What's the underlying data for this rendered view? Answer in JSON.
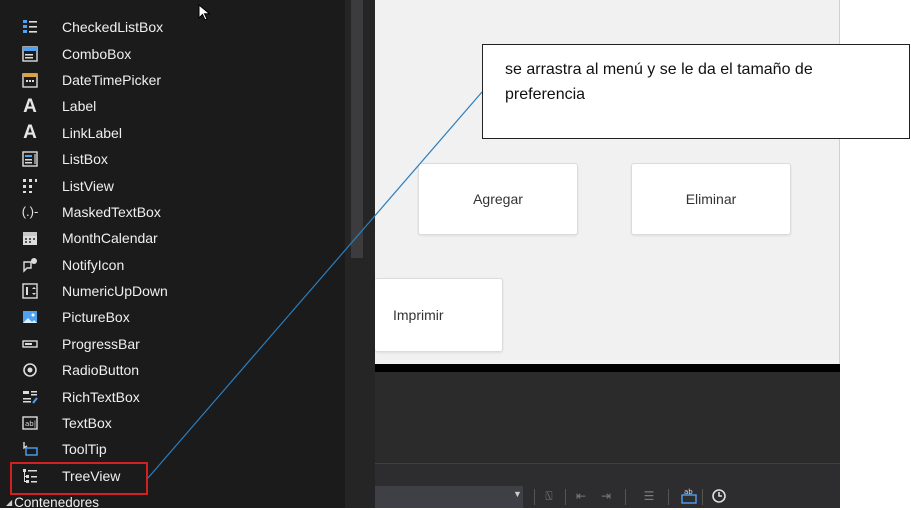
{
  "toolbox": {
    "items": [
      {
        "label": "CheckedListBox",
        "icon": "checked-list-icon"
      },
      {
        "label": "ComboBox",
        "icon": "combobox-icon"
      },
      {
        "label": "DateTimePicker",
        "icon": "datetime-icon"
      },
      {
        "label": "Label",
        "icon": "label-icon"
      },
      {
        "label": "LinkLabel",
        "icon": "linklabel-icon"
      },
      {
        "label": "ListBox",
        "icon": "listbox-icon"
      },
      {
        "label": "ListView",
        "icon": "listview-icon"
      },
      {
        "label": "MaskedTextBox",
        "icon": "masked-textbox-icon"
      },
      {
        "label": "MonthCalendar",
        "icon": "calendar-icon"
      },
      {
        "label": "NotifyIcon",
        "icon": "notify-icon"
      },
      {
        "label": "NumericUpDown",
        "icon": "numeric-updown-icon"
      },
      {
        "label": "PictureBox",
        "icon": "picture-icon"
      },
      {
        "label": "ProgressBar",
        "icon": "progressbar-icon"
      },
      {
        "label": "RadioButton",
        "icon": "radio-icon"
      },
      {
        "label": "RichTextBox",
        "icon": "richtext-icon"
      },
      {
        "label": "TextBox",
        "icon": "textbox-icon"
      },
      {
        "label": "ToolTip",
        "icon": "tooltip-icon"
      },
      {
        "label": "TreeView",
        "icon": "treeview-icon"
      }
    ],
    "section": "Contenedores"
  },
  "form": {
    "buttons": {
      "agregar": "Agregar",
      "eliminar": "Eliminar",
      "imprimir": "Imprimir"
    }
  },
  "annotation": {
    "text": "se arrastra al menú y se le da el tamaño de preferencia"
  },
  "colors": {
    "highlight": "#d32020",
    "callout_line": "#2a7fc0",
    "toolbox_bg": "#1b1b1c"
  }
}
